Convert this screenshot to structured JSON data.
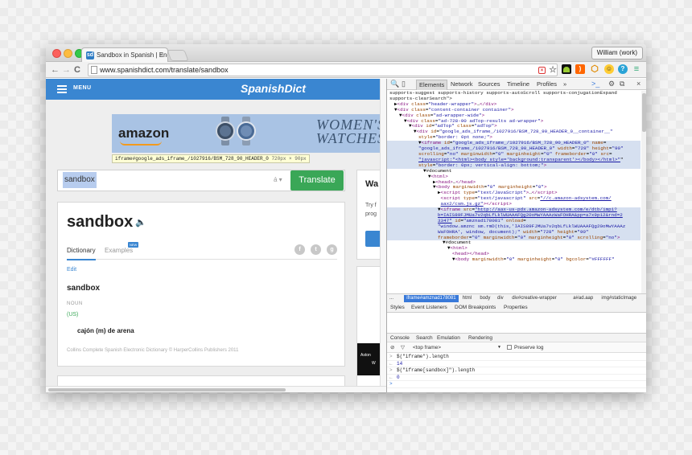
{
  "browser": {
    "tab_title": "Sandbox in Spanish | Engl",
    "tab_favicon": "sd",
    "url": "www.spanishdict.com/translate/sandbox",
    "user_label": "William (work)"
  },
  "site": {
    "menu_label": "MENU",
    "logo": "SpanishDict",
    "ad": {
      "brand": "amazon",
      "headline_line1": "WOMEN'S",
      "headline_line2": "WATCHES"
    },
    "tooltip_name": "iframe#google_ads_iframe_/1027916/BSM_728_90_HEADER_0",
    "tooltip_size": "720px × 90px",
    "search_value": "sandbox",
    "accent_label": "á ▾",
    "translate_label": "Translate",
    "headword": "sandbox",
    "tab_dictionary": "Dictionary",
    "tab_examples": "Examples",
    "new_badge": "NEW",
    "edit_label": "Edit",
    "entry_word": "sandbox",
    "pos": "NOUN",
    "region": "(US)",
    "translation": "cajón (m) de arena",
    "credit": "Collins Complete Spanish Electronic Dictionary © HarperCollins Publishers 2011",
    "side_title": "Wa",
    "side_line1": "Try f",
    "side_line2": "prog",
    "side_ad_line1": "Aston",
    "side_ad_line2": "W"
  },
  "devtools": {
    "panel_tabs": [
      "Elements",
      "Network",
      "Sources",
      "Timeline",
      "Profiles",
      "»"
    ],
    "active_tab": "Elements",
    "lines": [
      {
        "indent": 0,
        "html": "<span class='tx'>supports-suggest supports-history supports-autoScroll supports-conjugationExpand</span>"
      },
      {
        "indent": 0,
        "html": "<span class='tx'>supports-clearSearch\"&gt;</span>"
      },
      {
        "indent": 1,
        "html": "▶<span class='tg'>&lt;div</span> <span class='an'>class</span>=<span class='av'>\"header-wrapper\"</span><span class='tg'>&gt;</span>…<span class='tg'>&lt;/div&gt;</span>"
      },
      {
        "indent": 1,
        "html": "▼<span class='tg'>&lt;div</span> <span class='an'>class</span>=<span class='av'>\"content-container container\"</span><span class='tg'>&gt;</span>"
      },
      {
        "indent": 2,
        "html": "▼<span class='tg'>&lt;div</span> <span class='an'>class</span>=<span class='av'>\"ad-wrapper-wide\"</span><span class='tg'>&gt;</span>"
      },
      {
        "indent": 3,
        "html": "▼<span class='tg'>&lt;div</span> <span class='an'>class</span>=<span class='av'>\"ad-728-90 adTop-results ad-wrapper\"</span><span class='tg'>&gt;</span>"
      },
      {
        "indent": 4,
        "html": "▼<span class='tg'>&lt;div</span> <span class='an'>id</span>=<span class='av'>\"adTop\"</span> <span class='an'>class</span>=<span class='av'>\"adTop\"</span><span class='tg'>&gt;</span>"
      },
      {
        "indent": 5,
        "html": "▼<span class='tg'>&lt;div</span> <span class='an'>id</span>=<span class='av'>\"google_ads_iframe_/1027916/BSM_728_90_HEADER_0__container__\"</span>"
      },
      {
        "indent": 6,
        "html": "<span class='an'>style</span>=<span class='av'>\"border: 0pt none;\"</span><span class='tg'>&gt;</span>"
      },
      {
        "indent": 6,
        "cls": "hov",
        "html": "▼<span class='tg'>&lt;iframe</span> <span class='an'>id</span>=<span class='av'>\"google_ads_iframe_/1027916/BSM_728_90_HEADER_0\"</span> <span class='an'>name</span>="
      },
      {
        "indent": 6,
        "cls": "hov",
        "html": "<span class='av'>\"google_ads_iframe_/1027916/BSM_728_90_HEADER_0\"</span> <span class='an'>width</span>=<span class='av'>\"728\"</span> <span class='an'>height</span>=<span class='av'>\"90\"</span>"
      },
      {
        "indent": 6,
        "cls": "hov",
        "html": "<span class='an'>scrolling</span>=<span class='av'>\"no\"</span> <span class='an'>marginwidth</span>=<span class='av'>\"0\"</span> <span class='an'>marginheight</span>=<span class='av'>\"0\"</span> <span class='an'>frameborder</span>=<span class='av'>\"0\"</span> <span class='an'>src</span>="
      },
      {
        "indent": 6,
        "cls": "hov",
        "html": "<span class='lk'>\"javascript:\"&lt;html&gt;&lt;body style='background:transparent'&gt;&lt;/body&gt;&lt;/html&gt;\"</span>\""
      },
      {
        "indent": 6,
        "cls": "hov",
        "html": "<span class='an'>style</span>=<span class='av'>\"border: 0px; vertical-align: bottom;\"</span><span class='tg'>&gt;</span>"
      },
      {
        "indent": 7,
        "html": "▼#document"
      },
      {
        "indent": 8,
        "html": "▼<span class='tg'>&lt;html&gt;</span>"
      },
      {
        "indent": 9,
        "html": "▶<span class='tg'>&lt;head&gt;</span>…<span class='tg'>&lt;/head&gt;</span>"
      },
      {
        "indent": 9,
        "html": "▼<span class='tg'>&lt;body</span> <span class='an'>marginwidth</span>=<span class='av'>\"0\"</span> <span class='an'>marginheight</span>=<span class='av'>\"0\"</span><span class='tg'>&gt;</span>"
      },
      {
        "indent": 10,
        "html": "▶<span class='tg'>&lt;script</span> <span class='an'>type</span>=<span class='av'>\"text/JavaScript\"</span><span class='tg'>&gt;</span>…<span class='tg'>&lt;/script&gt;</span>"
      },
      {
        "indent": 10,
        "html": "&nbsp;<span class='tg'>&lt;script</span> <span class='an'>type</span>=<span class='av'>\"text/javascript\"</span> <span class='an'>src</span>=<span class='lk'>\"//c.amazon-adsystem.com/</span>"
      },
      {
        "indent": 10,
        "html": "&nbsp;<span class='lk'>aax2/csm.js.gz\"</span><span class='tg'>&gt;&lt;/script&gt;</span>"
      },
      {
        "indent": 10,
        "cls": "sel",
        "html": "▼<span class='tg'>&lt;iframe</span> <span class='an'>src</span>=<span class='lk'>\"http://aax-us-pdx.amazon-adsystem.com/e/dtb/imp1?</span>"
      },
      {
        "indent": 10,
        "cls": "sel",
        "html": "<span class='lk'>b=IAIS89FJMUa7v2qbLfLklWUAAAFQg20oMwYAAAzWaFOHRA&amp;pp=a7x9p12&amp;rnd=2</span>"
      },
      {
        "indent": 10,
        "cls": "sel",
        "html": "<span class='lk'>3347\"</span> <span class='an'>id</span>=<span class='av'>\"amznad178081\"</span> <span class='an'>onload</span>="
      },
      {
        "indent": 10,
        "cls": "sel",
        "html": "<span class='av'>\"window.amznc sm.rmD(this,'IAIS89FJMUa7v2qbLfLklWUAAAFQg20oMwYAAAz</span>"
      },
      {
        "indent": 10,
        "cls": "sel",
        "html": "<span class='av'>WaFOHRA', window, document);\"</span> <span class='an'>width</span>=<span class='av'>\"728\"</span> <span class='an'>height</span>=<span class='av'>\"90\"</span>"
      },
      {
        "indent": 10,
        "cls": "sel",
        "html": "<span class='an'>frameborder</span>=<span class='av'>\"0\"</span> <span class='an'>marginwidth</span>=<span class='av'>\"0\"</span> <span class='an'>marginheight</span>=<span class='av'>\"0\"</span> <span class='an'>scrolling</span>=<span class='av'>\"no\"</span><span class='tg'>&gt;</span>"
      },
      {
        "indent": 11,
        "html": "▼#document"
      },
      {
        "indent": 12,
        "html": "▼<span class='tg'>&lt;html&gt;</span>"
      },
      {
        "indent": 13,
        "html": "<span class='tg'>&lt;head&gt;&lt;/head&gt;</span>"
      },
      {
        "indent": 13,
        "html": "▼<span class='tg'>&lt;body</span> <span class='an'>marginwidth</span>=<span class='av'>\"0\"</span> <span class='an'>marginheight</span>=<span class='av'>\"0\"</span> <span class='an'>bgcolor</span>=<span class='av'>\"#FFFFFF\"</span>"
      }
    ],
    "breadcrumbs": [
      "...",
      "iframe#amznad178081",
      "html",
      "body",
      "div",
      "div#creative-wrapper",
      "a#ad.aap",
      "img#staticImage"
    ],
    "active_crumb": "iframe#amznad178081",
    "style_tabs": [
      "Styles",
      "Event Listeners",
      "DOM Breakpoints",
      "Properties"
    ],
    "drawer_tabs": [
      "Console",
      "Search",
      "Emulation",
      "Rendering"
    ],
    "frame_select": "<top frame>",
    "preserve_log": "Preserve log",
    "console": [
      {
        "kind": "in",
        "text": "$(\"iframe\").length"
      },
      {
        "kind": "out",
        "text": "14"
      },
      {
        "kind": "in",
        "text": "$(\"iframe[sandbox]\").length"
      },
      {
        "kind": "out",
        "text": "0"
      },
      {
        "kind": "prompt",
        "text": ""
      }
    ]
  },
  "colors": {
    "brand_blue": "#3a86d1",
    "translate_green": "#3aa757",
    "selection_blue": "#3879d9"
  }
}
